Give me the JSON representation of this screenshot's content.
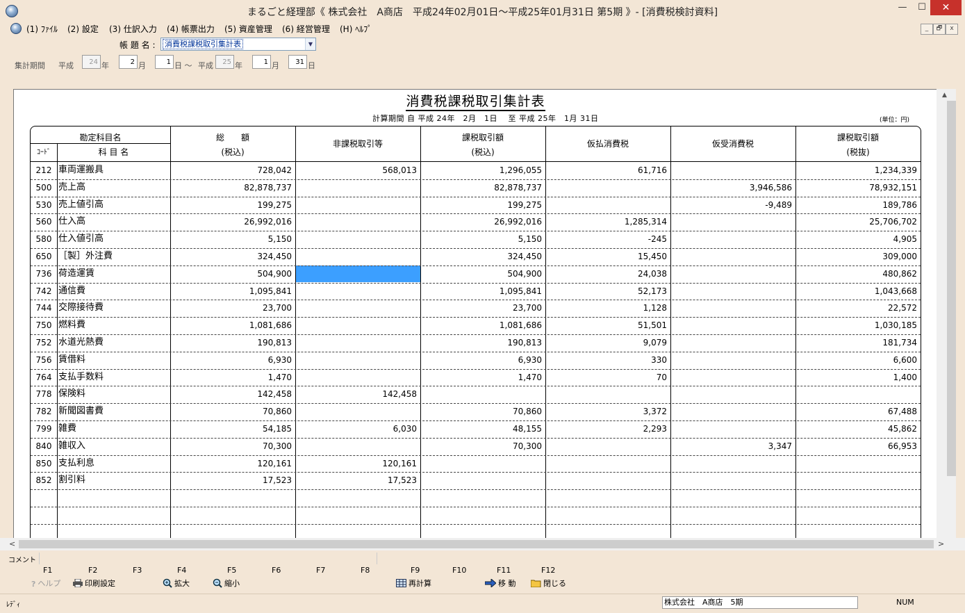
{
  "window": {
    "title": "まるごと経理部《 株式会社　A商店　平成24年02月01日～平成25年01月31日 第5期 》- [消費税検討資料]",
    "min_glyph": "—",
    "max_glyph": "☐",
    "close_glyph": "✕"
  },
  "menu": {
    "items": [
      "(1) ﾌｧｲﾙ",
      "(2) 設定",
      "(3) 仕訳入力",
      "(4) 帳票出力",
      "(5) 資産管理",
      "(6) 経営管理",
      "(H) ﾍﾙﾌﾟ"
    ],
    "mdi": [
      "_",
      "🗗",
      "x"
    ]
  },
  "form": {
    "report_label": "帳 題 名 :",
    "report_value": "消費税課税取引集計表",
    "period_label": "集計期間",
    "era1": "平成",
    "year1": "24",
    "year1_unit": "年",
    "month1": "2",
    "month1_unit": "月",
    "day1": "1",
    "day1_unit": "日 ～",
    "era2": "平成",
    "year2": "25",
    "year2_unit": "年",
    "month2": "1",
    "month2_unit": "月",
    "day2": "31",
    "day2_unit": "日"
  },
  "report": {
    "title": "消費税課税取引集計表",
    "period": "計算期間 自 平成 24年　2月　1日　 至 平成 25年　1月 31日",
    "unit": "(単位：円)",
    "headers": {
      "account_group": "勘定科目名",
      "code": "ｺｰﾄﾞ",
      "account_name": "科 目 名",
      "col1_a": "総　　額",
      "col1_b": "(税込)",
      "col2": "非課税取引等",
      "col3_a": "課税取引額",
      "col3_b": "(税込)",
      "col4": "仮払消費税",
      "col5": "仮受消費税",
      "col6_a": "課税取引額",
      "col6_b": "(税抜)"
    },
    "rows": [
      {
        "code": "212",
        "name": "車両運搬具",
        "total": "728,042",
        "nontax": "568,013",
        "taxable": "1,296,055",
        "input_tax": "61,716",
        "output_tax": "",
        "net": "1,234,339"
      },
      {
        "code": "500",
        "name": "売上高",
        "total": "82,878,737",
        "nontax": "",
        "taxable": "82,878,737",
        "input_tax": "",
        "output_tax": "3,946,586",
        "net": "78,932,151"
      },
      {
        "code": "530",
        "name": "売上値引高",
        "total": "199,275",
        "nontax": "",
        "taxable": "199,275",
        "input_tax": "",
        "output_tax": "-9,489",
        "net": "189,786"
      },
      {
        "code": "560",
        "name": "仕入高",
        "total": "26,992,016",
        "nontax": "",
        "taxable": "26,992,016",
        "input_tax": "1,285,314",
        "output_tax": "",
        "net": "25,706,702"
      },
      {
        "code": "580",
        "name": "仕入値引高",
        "total": "5,150",
        "nontax": "",
        "taxable": "5,150",
        "input_tax": "-245",
        "output_tax": "",
        "net": "4,905"
      },
      {
        "code": "650",
        "name": "［製］外注費",
        "total": "324,450",
        "nontax": "",
        "taxable": "324,450",
        "input_tax": "15,450",
        "output_tax": "",
        "net": "309,000"
      },
      {
        "code": "736",
        "name": "荷造運賃",
        "total": "504,900",
        "nontax": "",
        "taxable": "504,900",
        "input_tax": "24,038",
        "output_tax": "",
        "net": "480,862"
      },
      {
        "code": "742",
        "name": "通信費",
        "total": "1,095,841",
        "nontax": "",
        "taxable": "1,095,841",
        "input_tax": "52,173",
        "output_tax": "",
        "net": "1,043,668"
      },
      {
        "code": "744",
        "name": "交際接待費",
        "total": "23,700",
        "nontax": "",
        "taxable": "23,700",
        "input_tax": "1,128",
        "output_tax": "",
        "net": "22,572"
      },
      {
        "code": "750",
        "name": "燃料費",
        "total": "1,081,686",
        "nontax": "",
        "taxable": "1,081,686",
        "input_tax": "51,501",
        "output_tax": "",
        "net": "1,030,185"
      },
      {
        "code": "752",
        "name": "水道光熱費",
        "total": "190,813",
        "nontax": "",
        "taxable": "190,813",
        "input_tax": "9,079",
        "output_tax": "",
        "net": "181,734"
      },
      {
        "code": "756",
        "name": "賃借料",
        "total": "6,930",
        "nontax": "",
        "taxable": "6,930",
        "input_tax": "330",
        "output_tax": "",
        "net": "6,600"
      },
      {
        "code": "764",
        "name": "支払手数料",
        "total": "1,470",
        "nontax": "",
        "taxable": "1,470",
        "input_tax": "70",
        "output_tax": "",
        "net": "1,400"
      },
      {
        "code": "778",
        "name": "保険料",
        "total": "142,458",
        "nontax": "142,458",
        "taxable": "",
        "input_tax": "",
        "output_tax": "",
        "net": ""
      },
      {
        "code": "782",
        "name": "新聞図書費",
        "total": "70,860",
        "nontax": "",
        "taxable": "70,860",
        "input_tax": "3,372",
        "output_tax": "",
        "net": "67,488"
      },
      {
        "code": "799",
        "name": "雑費",
        "total": "54,185",
        "nontax": "6,030",
        "taxable": "48,155",
        "input_tax": "2,293",
        "output_tax": "",
        "net": "45,862"
      },
      {
        "code": "840",
        "name": "雑収入",
        "total": "70,300",
        "nontax": "",
        "taxable": "70,300",
        "input_tax": "",
        "output_tax": "3,347",
        "net": "66,953"
      },
      {
        "code": "850",
        "name": "支払利息",
        "total": "120,161",
        "nontax": "120,161",
        "taxable": "",
        "input_tax": "",
        "output_tax": "",
        "net": ""
      },
      {
        "code": "852",
        "name": "割引料",
        "total": "17,523",
        "nontax": "17,523",
        "taxable": "",
        "input_tax": "",
        "output_tax": "",
        "net": ""
      }
    ],
    "selected_row": 6
  },
  "comment_label": "コメント",
  "fkeys": {
    "labels": [
      "F1",
      "F2",
      "F3",
      "F4",
      "F5",
      "F6",
      "F7",
      "F8",
      "F9",
      "F10",
      "F11",
      "F12"
    ],
    "help": "ヘルプ",
    "print": "印刷設定",
    "zoom_in": "拡大",
    "zoom_out": "縮小",
    "recalc": "再計算",
    "move": "移 動",
    "close": "閉じる"
  },
  "status": {
    "ready": "ﾚﾃﾞｨ",
    "company": "株式会社　A商店　5期",
    "numlock": "NUM"
  }
}
